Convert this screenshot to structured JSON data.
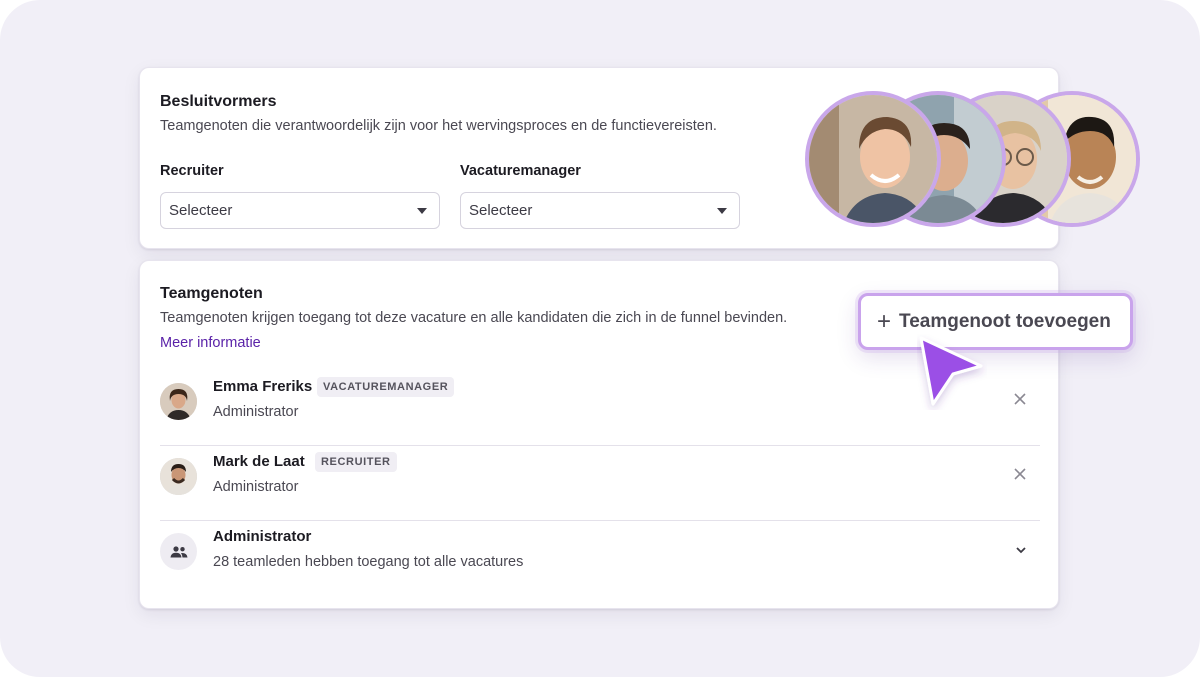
{
  "decision_makers": {
    "title": "Besluitvormers",
    "description": "Teamgenoten die verantwoordelijk zijn voor het wervingsproces en de functievereisten.",
    "recruiter_label": "Recruiter",
    "recruiter_value": "Selecteer",
    "manager_label": "Vacaturemanager",
    "manager_value": "Selecteer"
  },
  "team": {
    "title": "Teamgenoten",
    "description": "Teamgenoten krijgen toegang tot deze vacature en alle kandidaten die zich in de funnel bevinden.",
    "more_link": "Meer informatie",
    "add_button": "Teamgenoot toevoegen",
    "members": [
      {
        "name": "Emma Freriks",
        "badge": "VACATUREMANAGER",
        "role": "Administrator"
      },
      {
        "name": "Mark de Laat",
        "badge": "RECRUITER",
        "role": "Administrator"
      },
      {
        "name": "Administrator",
        "badge": "",
        "role": "28 teamleden hebben toegang tot alle vacatures"
      }
    ]
  },
  "colors": {
    "accent": "#5a22a8",
    "ring": "#c9a7ea",
    "cursor": "#9b4fe6",
    "background": "#f1eff7"
  },
  "icons": [
    "caret-down-icon",
    "plus-icon",
    "cursor-arrow-icon",
    "close-icon",
    "group-icon",
    "chevron-down-icon"
  ]
}
